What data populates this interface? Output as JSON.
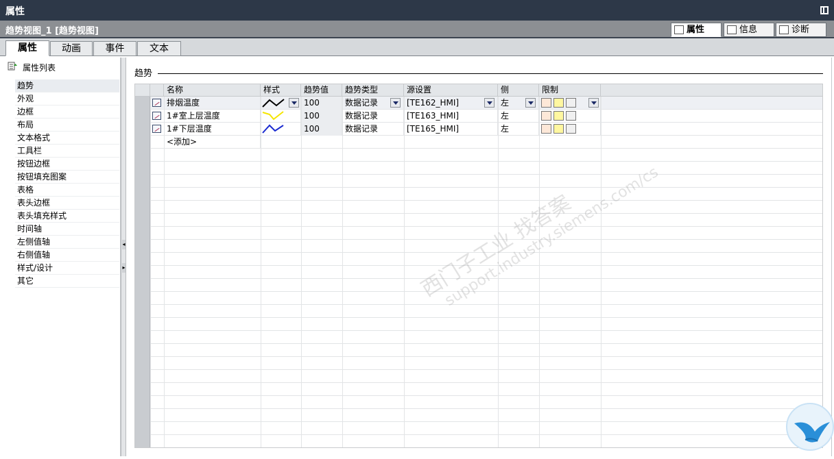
{
  "window": {
    "title": "属性"
  },
  "object": {
    "name": "趋势视图_1 [趋势视图]"
  },
  "inspector_tabs": [
    {
      "label": "属性"
    },
    {
      "label": "信息"
    },
    {
      "label": "诊断"
    }
  ],
  "prop_tabs": [
    {
      "label": "属性"
    },
    {
      "label": "动画"
    },
    {
      "label": "事件"
    },
    {
      "label": "文本"
    }
  ],
  "sidebar": {
    "header": "属性列表",
    "items": [
      {
        "label": "趋势"
      },
      {
        "label": "外观"
      },
      {
        "label": "边框"
      },
      {
        "label": "布局"
      },
      {
        "label": "文本格式"
      },
      {
        "label": "工具栏"
      },
      {
        "label": "按钮边框"
      },
      {
        "label": "按钮填充图案"
      },
      {
        "label": "表格"
      },
      {
        "label": "表头边框"
      },
      {
        "label": "表头填充样式"
      },
      {
        "label": "时间轴"
      },
      {
        "label": "左侧值轴"
      },
      {
        "label": "右侧值轴"
      },
      {
        "label": "样式/设计"
      },
      {
        "label": "其它"
      }
    ]
  },
  "section": {
    "title": "趋势"
  },
  "table": {
    "headers": {
      "name": "名称",
      "style": "样式",
      "value": "趋势值",
      "type": "趋势类型",
      "source": "源设置",
      "side": "侧",
      "limit": "限制"
    },
    "rows": [
      {
        "name": "排烟温度",
        "style_color": "#000000",
        "value": "100",
        "type": "数据记录",
        "source": "[TE162_HMI]",
        "side": "左"
      },
      {
        "name": "1#室上层温度",
        "style_color": "#f5e600",
        "value": "100",
        "type": "数据记录",
        "source": "[TE163_HMI]",
        "side": "左"
      },
      {
        "name": "1#下层温度",
        "style_color": "#1a2ad0",
        "value": "100",
        "type": "数据记录",
        "source": "[TE165_HMI]",
        "side": "左"
      }
    ],
    "add_label": "<添加>"
  },
  "watermark": {
    "line1": "西门子工业 找答案",
    "line2": "support.industry.siemens.com/cs"
  }
}
